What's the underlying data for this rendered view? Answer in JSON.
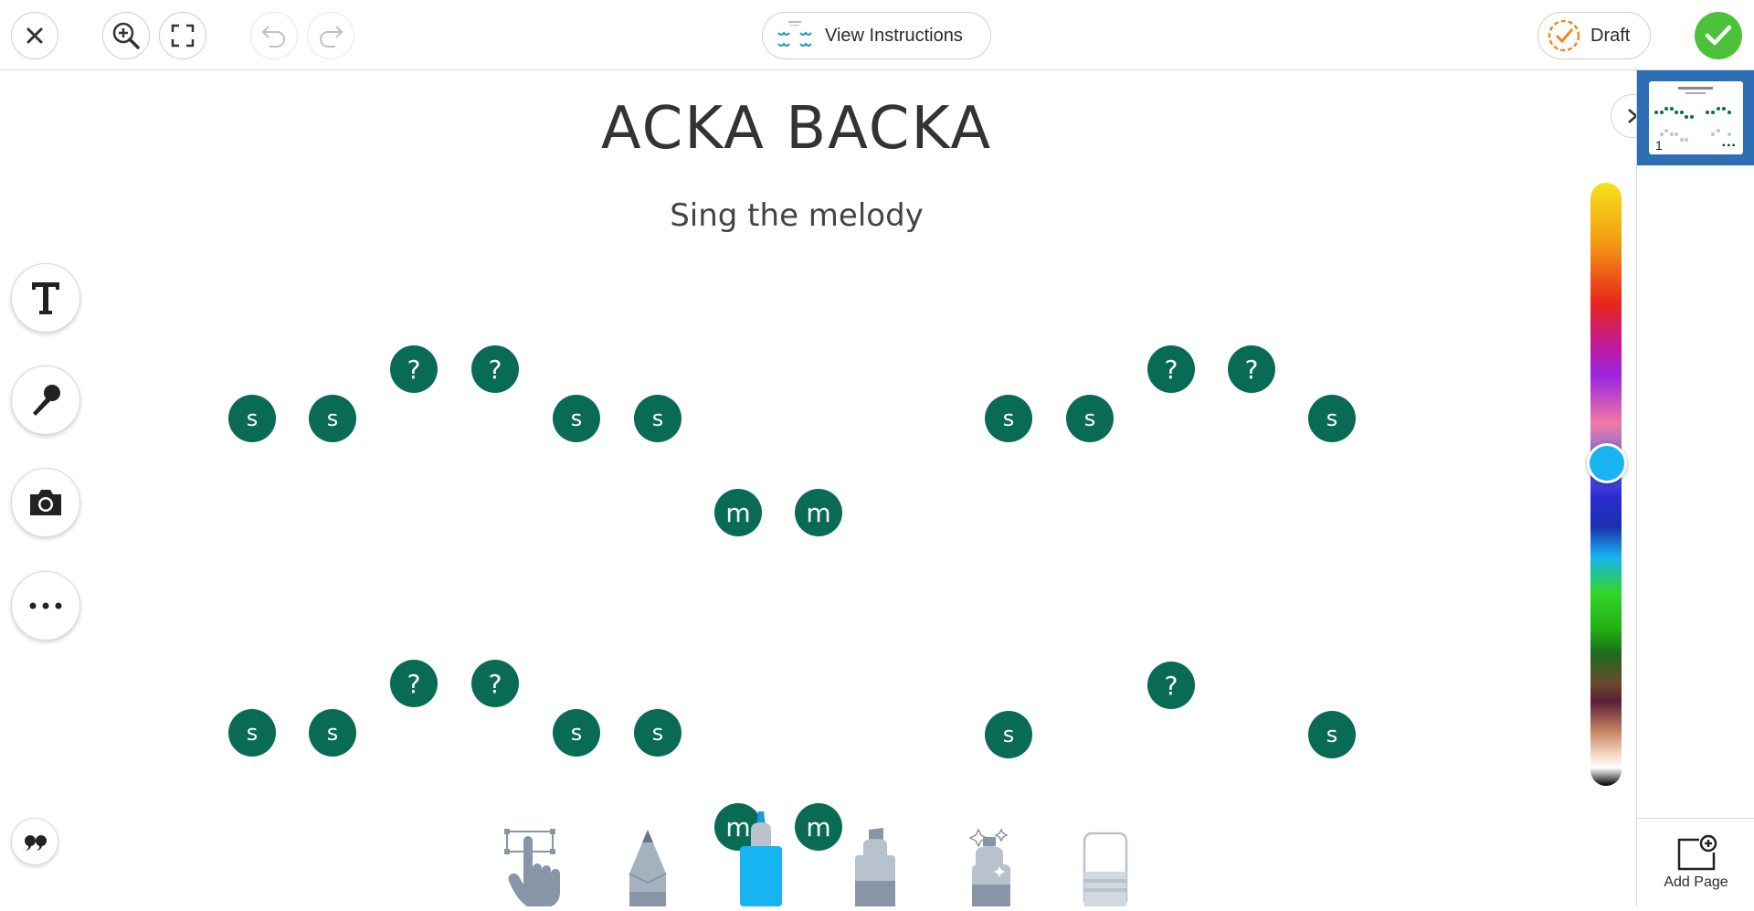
{
  "toolbar": {
    "close_icon": "close-icon",
    "zoom_icon": "zoom-in-icon",
    "fullscreen_icon": "fullscreen-icon",
    "undo_icon": "undo-icon",
    "redo_icon": "redo-icon",
    "view_instructions_label": "View Instructions",
    "draft_label": "Draft",
    "done_icon": "check-icon"
  },
  "colors": {
    "note_green": "#0a6b55",
    "done_green": "#4cc13a",
    "selected_color": "#1ab4f2",
    "thumb_highlight": "#2c6fb5",
    "draft_orange": "#f08a1c"
  },
  "canvas": {
    "title": "ACKA BACKA",
    "subtitle": "Sing the melody",
    "row1": {
      "notes": [
        "s",
        "s",
        "?",
        "?",
        "s",
        "s",
        "m",
        "m",
        "s",
        "s",
        "?",
        "?",
        "s"
      ]
    },
    "row2": {
      "notes": [
        "s",
        "s",
        "?",
        "?",
        "s",
        "s",
        "m",
        "m",
        "s",
        "?",
        "s"
      ]
    }
  },
  "pages_panel": {
    "page_number": "1",
    "page_menu": "...",
    "add_page_label": "Add Page"
  },
  "side_tools": [
    "text-tool",
    "microphone-tool",
    "camera-tool",
    "more-tool"
  ],
  "bottom_tools": [
    "select-tool",
    "pencil-tool",
    "marker-tool",
    "highlighter-tool",
    "spray-tool",
    "eraser-tool"
  ],
  "color_picker": {
    "selected": "#1ab4f2",
    "selected_fraction": 0.45
  }
}
